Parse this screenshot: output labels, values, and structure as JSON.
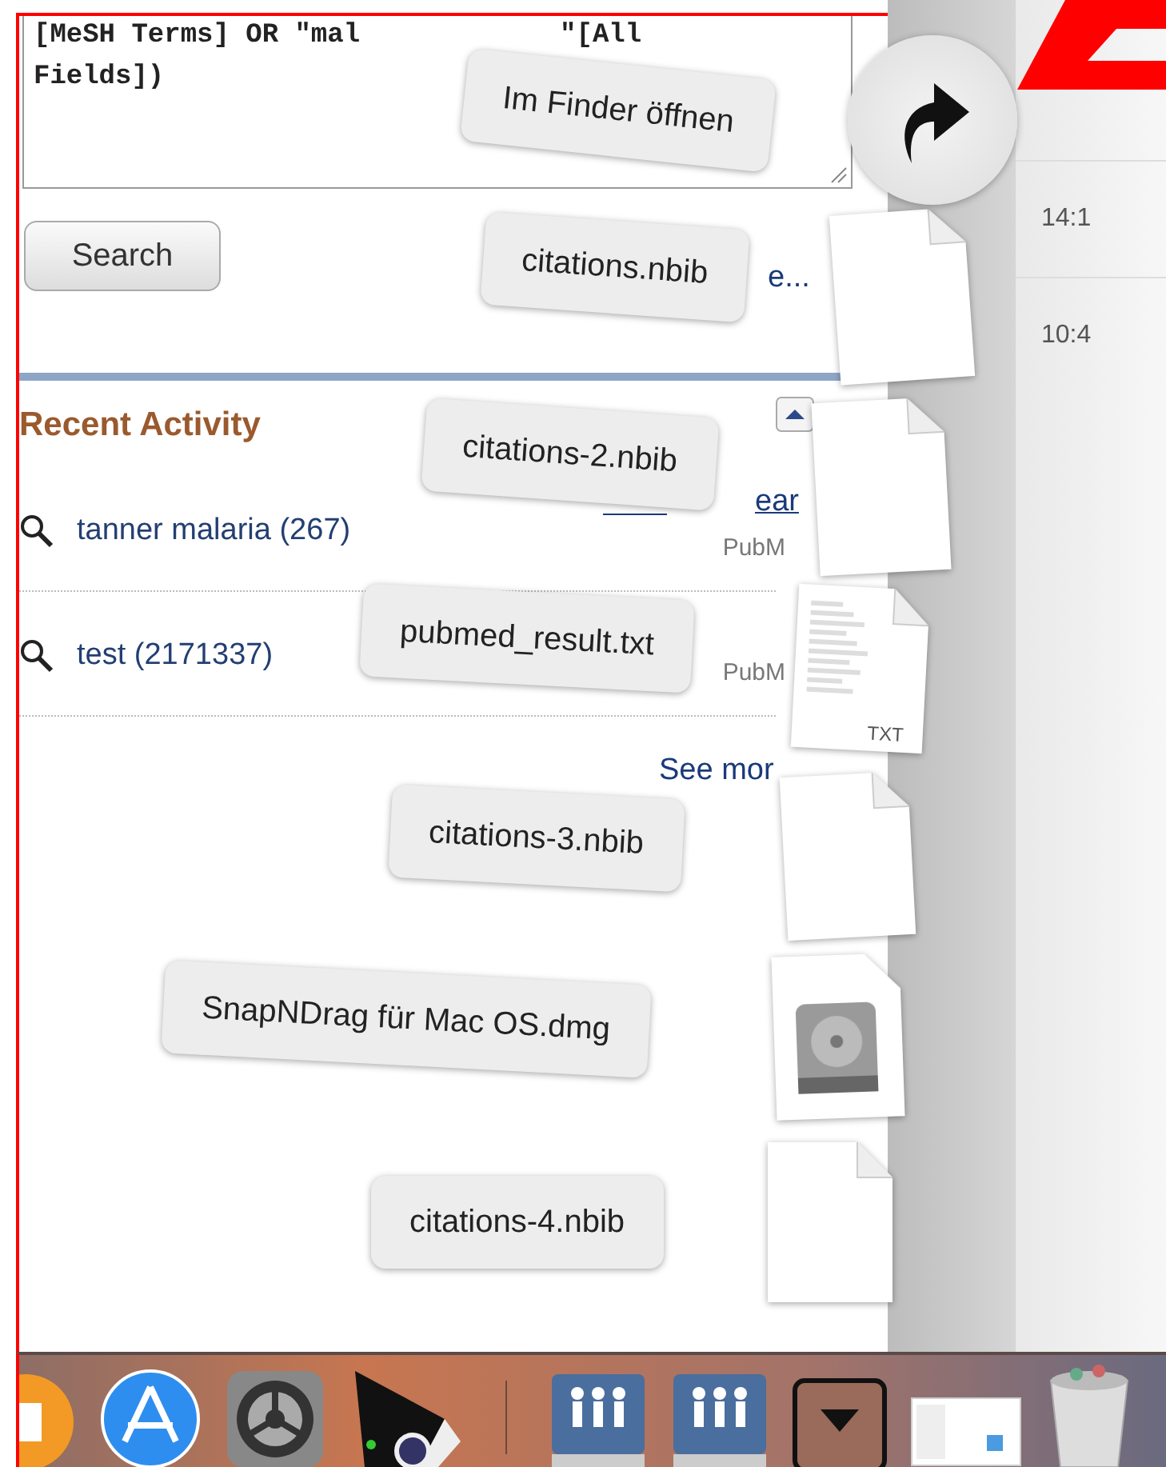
{
  "query_box": {
    "lines": [
      {
        "parts": [
          "[MeSH Terms] OR \"mal",
          "\"[All"
        ]
      },
      {
        "parts": [
          "Fields])"
        ]
      }
    ]
  },
  "search_button": "Search",
  "link_fragment": "e...",
  "recent_activity": {
    "title": "Recent Activity",
    "clear_fragment": "ear",
    "items": [
      {
        "label": "tanner malaria (267)",
        "database": "PubM"
      },
      {
        "label": "test (2171337)",
        "database": "PubM"
      }
    ],
    "see_more": "See mor"
  },
  "times": [
    "14:1",
    "10:4"
  ],
  "stack": {
    "open_label": "Im Finder öffnen",
    "files": [
      {
        "name": "citations.nbib",
        "kind": "document"
      },
      {
        "name": "citations-2.nbib",
        "kind": "document"
      },
      {
        "name": "pubmed_result.txt",
        "kind": "text",
        "badge": "TXT"
      },
      {
        "name": "citations-3.nbib",
        "kind": "document"
      },
      {
        "name": "SnapNDrag für Mac OS.dmg",
        "kind": "disk"
      },
      {
        "name": "citations-4.nbib",
        "kind": "document"
      }
    ]
  },
  "dock": [
    {
      "kind": "books"
    },
    {
      "kind": "appstore"
    },
    {
      "kind": "settings"
    },
    {
      "kind": "projector"
    },
    {
      "kind": "divider"
    },
    {
      "kind": "shared"
    },
    {
      "kind": "shared"
    },
    {
      "kind": "stack"
    },
    {
      "kind": "thumbnail"
    },
    {
      "kind": "trash"
    }
  ]
}
